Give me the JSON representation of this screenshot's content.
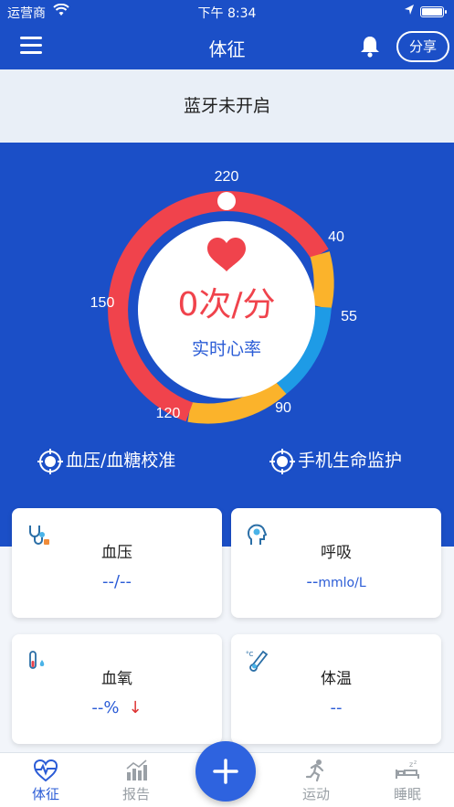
{
  "status_bar": {
    "carrier": "运营商",
    "time": "下午 8:34"
  },
  "nav": {
    "title": "体征",
    "share_label": "分享"
  },
  "banner": {
    "text": "蓝牙未开启"
  },
  "gauge": {
    "value_text": "0次/分",
    "caption": "实时心率",
    "tick_labels": [
      "220",
      "40",
      "55",
      "90",
      "120",
      "150"
    ],
    "colors": {
      "red": "#f0434c",
      "yellow": "#fbb32b",
      "blue": "#1e9be6",
      "value": "#f0434c"
    }
  },
  "actions": {
    "calibrate": "血压/血糖校准",
    "monitor": "手机生命监护"
  },
  "cards": [
    {
      "label": "血压",
      "value": "--/--",
      "icon": "stethoscope-icon"
    },
    {
      "label": "呼吸",
      "value": "--",
      "unit": "mmlo/L",
      "icon": "head-icon"
    },
    {
      "label": "血氧",
      "value": "--%",
      "icon": "test-tube-icon"
    },
    {
      "label": "体温",
      "value": "--",
      "icon": "thermometer-icon"
    }
  ],
  "tabs": [
    {
      "label": "体征",
      "icon": "heart-pulse-icon",
      "active": true
    },
    {
      "label": "报告",
      "icon": "bar-chart-icon"
    },
    {
      "label": "运动",
      "icon": "runner-icon"
    },
    {
      "label": "睡眠",
      "icon": "sleep-icon"
    }
  ],
  "fab": {
    "icon": "plus-icon"
  }
}
